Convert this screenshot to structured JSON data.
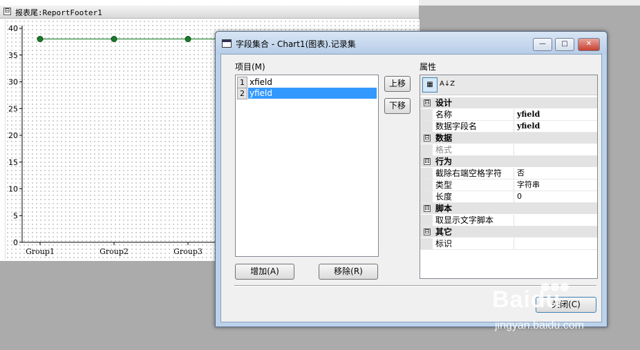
{
  "designer": {
    "band_title": "报表尾:ReportFooter1",
    "band_toggle": "⊟"
  },
  "chart_data": {
    "type": "line",
    "categories": [
      "Group1",
      "Group2",
      "Group3"
    ],
    "series": [
      {
        "values": [
          38,
          38,
          38
        ]
      }
    ],
    "yticks": [
      0,
      5,
      10,
      15,
      20,
      25,
      30,
      35,
      40
    ],
    "ylim": [
      0,
      40
    ],
    "line_color": "#2e8b3a",
    "marker_color": "#1a7a2a",
    "grid": "dotted"
  },
  "dialog": {
    "title": "字段集合 - Chart1(图表).记录集",
    "window_buttons": {
      "minimize": "—",
      "maximize": "□",
      "close": "✕"
    },
    "items_label": "项目(M)",
    "items": [
      {
        "num": "1",
        "name": "xfield",
        "selected": false
      },
      {
        "num": "2",
        "name": "yfield",
        "selected": true
      }
    ],
    "move_up": "上移",
    "move_down": "下移",
    "add_button": "增加(A)",
    "remove_button": "移除(R)",
    "properties_label": "属性",
    "toolbar": {
      "categorized": "▦",
      "alphabetical": "A↓Z"
    },
    "categories": [
      {
        "name": "设计",
        "toggle": "⊟",
        "props": [
          {
            "name": "名称",
            "value": "yfield",
            "bold": true
          },
          {
            "name": "数据字段名",
            "value": "yfield",
            "bold": true
          }
        ]
      },
      {
        "name": "数据",
        "toggle": "⊟",
        "props": [
          {
            "name": "格式",
            "value": "",
            "disabled": true
          }
        ]
      },
      {
        "name": "行为",
        "toggle": "⊟",
        "props": [
          {
            "name": "截除右端空格字符",
            "value": "否"
          },
          {
            "name": "类型",
            "value": "字符串"
          },
          {
            "name": "长度",
            "value": "0"
          }
        ]
      },
      {
        "name": "脚本",
        "toggle": "⊟",
        "props": [
          {
            "name": "取显示文字脚本",
            "value": ""
          }
        ]
      },
      {
        "name": "其它",
        "toggle": "⊟",
        "props": [
          {
            "name": "标识",
            "value": ""
          }
        ]
      }
    ],
    "close_button": "关闭(C)"
  },
  "watermark": {
    "brand": "Baidu",
    "site": "jingyan.baidu.com"
  }
}
